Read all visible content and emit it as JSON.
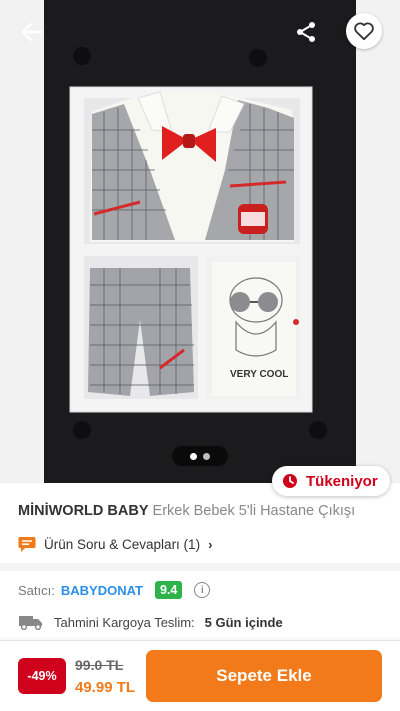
{
  "header": {
    "back_icon": "arrow-left-icon",
    "share_icon": "share-icon",
    "favorite_icon": "heart-outline-icon"
  },
  "gallery": {
    "image_count": 2,
    "active_index": 0,
    "stock_badge": {
      "icon": "clock-icon",
      "label": "Tükeniyor",
      "color": "#d0021b"
    },
    "garment_print": "VERY COOL"
  },
  "product": {
    "brand": "MİNİWORLD BABY",
    "name": "Erkek Bebek 5'li Hastane Çıkışı"
  },
  "qa": {
    "icon": "chat-bubble-icon",
    "label": "Ürün Soru & Cevapları (1)",
    "chevron": "›"
  },
  "seller": {
    "label": "Satıcı:",
    "name": "BABYDONAT",
    "score": "9.4",
    "info_icon": "info-icon"
  },
  "shipping": {
    "icon": "truck-icon",
    "label": "Tahmini Kargoya Teslim:",
    "value": "5 Gün içinde"
  },
  "price": {
    "discount": "-49%",
    "old": "99.0 TL",
    "current": "49.99 TL"
  },
  "cart": {
    "label": "Sepete Ekle"
  },
  "colors": {
    "brand_orange": "#f27a1a",
    "discount_red": "#d0021b",
    "seller_blue": "#2b8ee8",
    "score_green": "#2db34a"
  }
}
